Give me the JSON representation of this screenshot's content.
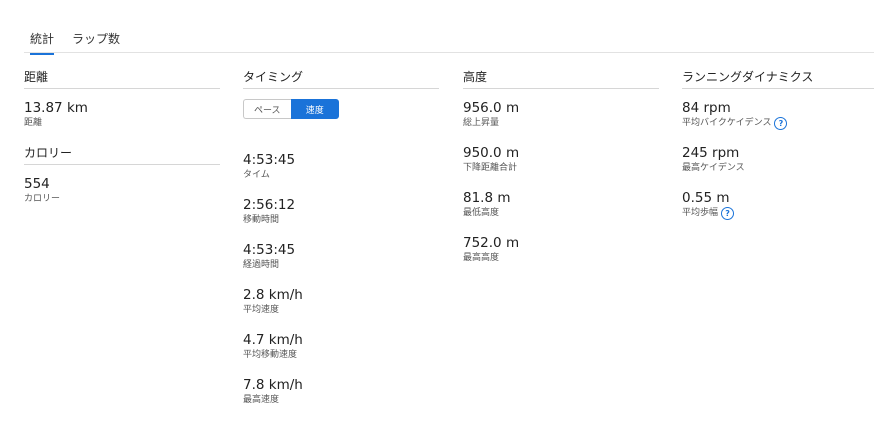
{
  "tabs": [
    "統計",
    "ラップ数"
  ],
  "distance": {
    "title": "距離",
    "stats": [
      {
        "value": "13.87 km",
        "label": "距離"
      }
    ]
  },
  "calories": {
    "title": "カロリー",
    "stats": [
      {
        "value": "554",
        "label": "カロリー"
      }
    ]
  },
  "timing": {
    "title": "タイミング",
    "toggle": {
      "pace": "ペース",
      "speed": "速度"
    },
    "stats": [
      {
        "value": "4:53:45",
        "label": "タイム"
      },
      {
        "value": "2:56:12",
        "label": "移動時間"
      },
      {
        "value": "4:53:45",
        "label": "経過時間"
      },
      {
        "value": "2.8 km/h",
        "label": "平均速度"
      },
      {
        "value": "4.7 km/h",
        "label": "平均移動速度"
      },
      {
        "value": "7.8 km/h",
        "label": "最高速度"
      }
    ]
  },
  "elevation": {
    "title": "高度",
    "stats": [
      {
        "value": "956.0 m",
        "label": "総上昇量"
      },
      {
        "value": "950.0 m",
        "label": "下降距離合計"
      },
      {
        "value": "81.8 m",
        "label": "最低高度"
      },
      {
        "value": "752.0 m",
        "label": "最高高度"
      }
    ]
  },
  "running_dynamics": {
    "title": "ランニングダイナミクス",
    "stats": [
      {
        "value": "84 rpm",
        "label": "平均バイクケイデンス"
      },
      {
        "value": "245 rpm",
        "label": "最高ケイデンス"
      },
      {
        "value": "0.55 m",
        "label": "平均歩幅"
      }
    ]
  },
  "colors": {
    "accent": "#1a73d9"
  }
}
